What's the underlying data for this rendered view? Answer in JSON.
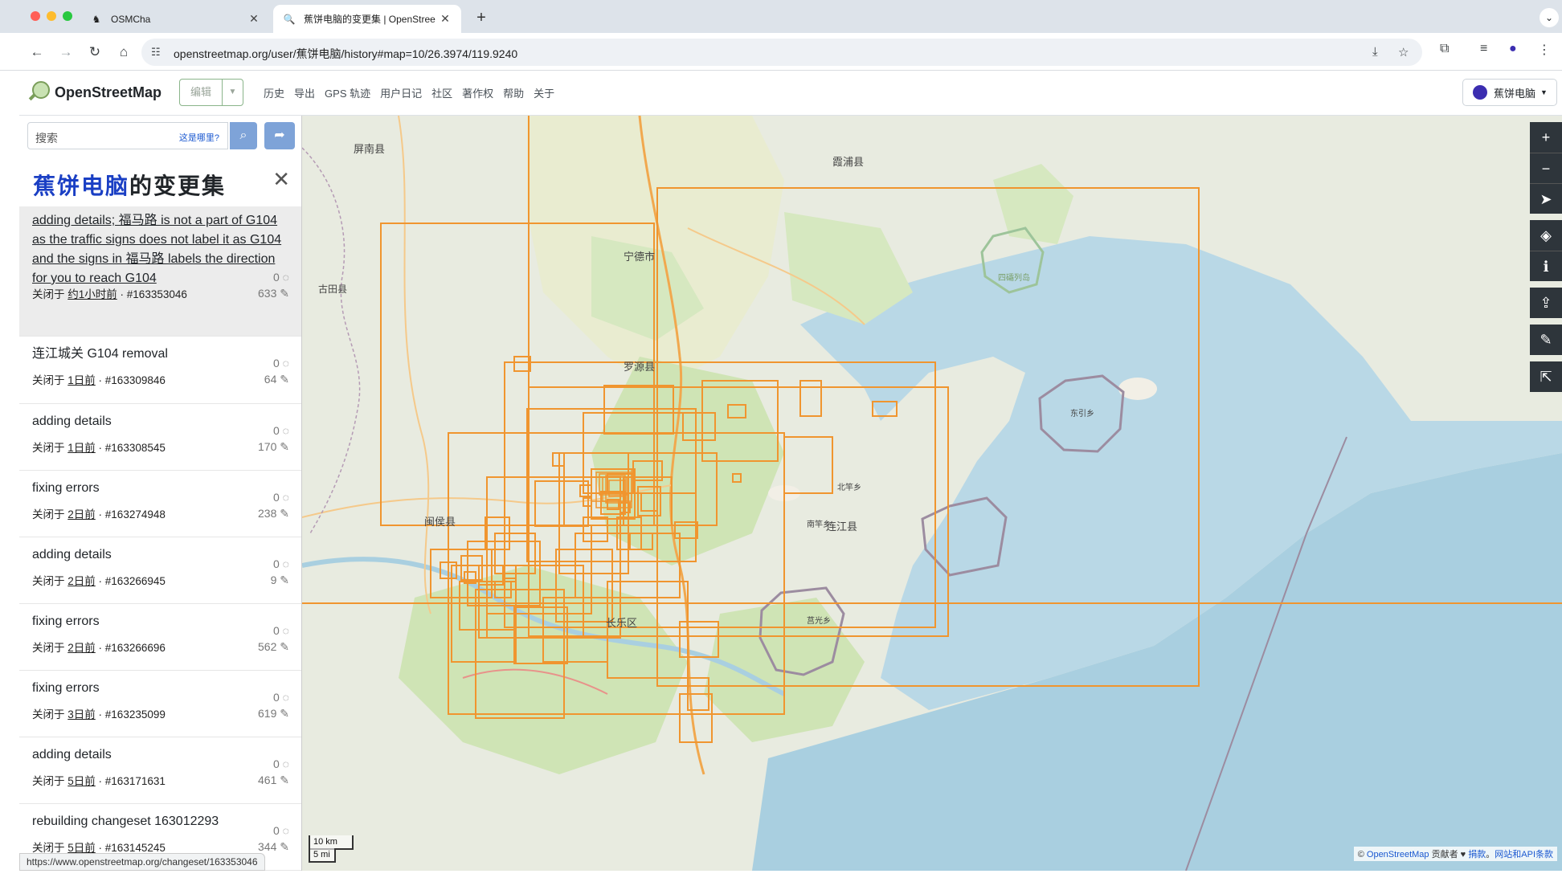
{
  "browser": {
    "tabs": [
      {
        "title": "OSMCha",
        "active": false
      },
      {
        "title": "蕉饼电脑的变更集 | OpenStree",
        "active": true
      }
    ],
    "url": "openstreetmap.org/user/蕉饼电脑/history#map=10/26.3974/119.9240",
    "status_url": "https://www.openstreetmap.org/changeset/163353046"
  },
  "header": {
    "brand": "OpenStreetMap",
    "edit_label": "编辑",
    "nav": [
      "历史",
      "导出",
      "GPS 轨迹",
      "用户日记",
      "社区",
      "著作权",
      "帮助",
      "关于"
    ],
    "username": "蕉饼电脑"
  },
  "sidebar": {
    "search_placeholder": "搜索",
    "where_am_i": "这是哪里?",
    "title_user": "蕉饼电脑",
    "title_suffix": "的变更集",
    "changesets": [
      {
        "comment": "adding details; 福马路 is not a part of G104 as the traffic signs does not label it as G104 and the signs in 福马路 labels the direction for you to reach G104",
        "closed": "关闭于",
        "time": "约1小时前",
        "id": "· #163353046",
        "comments": "0",
        "changes": "633"
      },
      {
        "comment": "连江城关 G104 removal",
        "closed": "关闭于",
        "time": "1日前",
        "id": "· #163309846",
        "comments": "0",
        "changes": "64"
      },
      {
        "comment": "adding details",
        "closed": "关闭于",
        "time": "1日前",
        "id": "· #163308545",
        "comments": "0",
        "changes": "170"
      },
      {
        "comment": "fixing errors",
        "closed": "关闭于",
        "time": "2日前",
        "id": "· #163274948",
        "comments": "0",
        "changes": "238"
      },
      {
        "comment": "adding details",
        "closed": "关闭于",
        "time": "2日前",
        "id": "· #163266945",
        "comments": "0",
        "changes": "9"
      },
      {
        "comment": "fixing errors",
        "closed": "关闭于",
        "time": "2日前",
        "id": "· #163266696",
        "comments": "0",
        "changes": "562"
      },
      {
        "comment": "fixing errors",
        "closed": "关闭于",
        "time": "3日前",
        "id": "· #163235099",
        "comments": "0",
        "changes": "619"
      },
      {
        "comment": "adding details",
        "closed": "关闭于",
        "time": "5日前",
        "id": "· #163171631",
        "comments": "0",
        "changes": "461"
      },
      {
        "comment": "rebuilding changeset 163012293",
        "closed": "关闭于",
        "time": "5日前",
        "id": "· #163145245",
        "comments": "0",
        "changes": "344"
      }
    ]
  },
  "map": {
    "scale_km": "10 km",
    "scale_mi": "5 mi",
    "attribution_prefix": "©",
    "attribution_osm": "OpenStreetMap",
    "attribution_mid": "贡献者 ♥",
    "attribution_donate": "捐款",
    "attribution_sep": "。",
    "attribution_terms": "网站和API条款",
    "labels": [
      {
        "text": "宁德市"
      },
      {
        "text": "罗源县"
      },
      {
        "text": "连江县"
      },
      {
        "text": "闽侯县"
      },
      {
        "text": "长乐区"
      },
      {
        "text": "霞浦县"
      },
      {
        "text": "屏南县"
      },
      {
        "text": "四礵列岛"
      },
      {
        "text": "东引乡"
      },
      {
        "text": "莒光乡"
      },
      {
        "text": "北竿乡"
      },
      {
        "text": "南竿乡"
      },
      {
        "text": "古田县"
      }
    ]
  },
  "colors": {
    "accent": "#f0952f",
    "osm_blue": "#1a3fc4",
    "sea": "#a9cfe0"
  }
}
